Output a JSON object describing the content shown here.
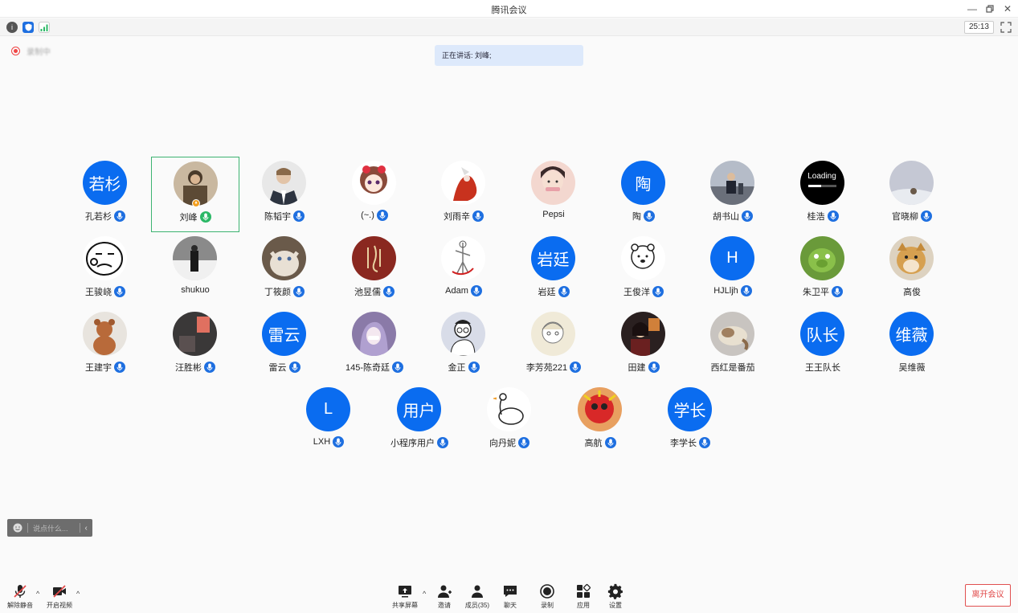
{
  "window": {
    "title": "腾讯会议",
    "timer": "25:13"
  },
  "recording": {
    "label": "录制中"
  },
  "speaking": {
    "text": "正在讲话: 刘峰;"
  },
  "colors": {
    "accent": "#0a6cf0",
    "mic": "#1e6fe0",
    "mic_active": "#2bb866",
    "leave": "#e04848",
    "active_border": "#3cb371"
  },
  "participants": [
    {
      "name": "孔若杉",
      "avatar_text": "若杉",
      "mic": true
    },
    {
      "name": "刘峰",
      "avatar_image": "person-photo",
      "mic": true,
      "speaking": true,
      "host": true
    },
    {
      "name": "陈韬宇",
      "avatar_image": "suit-man-photo",
      "mic": true
    },
    {
      "name": "(~.)",
      "avatar_image": "anime-girl",
      "mic": true
    },
    {
      "name": "刘雨辛",
      "avatar_image": "red-flower-drawing",
      "mic": true
    },
    {
      "name": "Pepsi",
      "avatar_image": "girl-photo",
      "mic": false
    },
    {
      "name": "陶",
      "avatar_text": "陶",
      "mic": true
    },
    {
      "name": "胡书山",
      "avatar_image": "man-sitting-photo",
      "mic": true
    },
    {
      "name": "桂浩",
      "avatar_image": "loading-image",
      "avatar_caption": "Loading",
      "mic": true
    },
    {
      "name": "官晓柳",
      "avatar_image": "snow-photo",
      "mic": true
    },
    {
      "name": "王骏峣",
      "avatar_image": "cartoon-face",
      "mic": true
    },
    {
      "name": "shukuo",
      "avatar_image": "snow-person-photo",
      "mic": false
    },
    {
      "name": "丁筱颜",
      "avatar_image": "cat-photo",
      "mic": true
    },
    {
      "name": "池昱儒",
      "avatar_image": "red-calligraphy",
      "mic": true
    },
    {
      "name": "Adam",
      "avatar_image": "sketch-figure",
      "mic": true
    },
    {
      "name": "岩廷",
      "avatar_text": "岩廷",
      "mic": true
    },
    {
      "name": "王俊洋",
      "avatar_image": "bear-sketch",
      "mic": true
    },
    {
      "name": "HJLljh",
      "avatar_text": "H",
      "mic": true
    },
    {
      "name": "朱卫平",
      "avatar_image": "pig-character",
      "mic": true
    },
    {
      "name": "高俊",
      "avatar_image": "dog-photo",
      "mic": false
    },
    {
      "name": "王建宇",
      "avatar_image": "teddy-bear-photo",
      "mic": true
    },
    {
      "name": "汪胜彬",
      "avatar_image": "dark-room-photo",
      "mic": true
    },
    {
      "name": "雷云",
      "avatar_text": "雷云",
      "mic": true
    },
    {
      "name": "145-陈奇廷",
      "avatar_image": "anime-purple-hair",
      "mic": true
    },
    {
      "name": "金正",
      "avatar_image": "glasses-cartoon",
      "mic": true
    },
    {
      "name": "李芳苑221",
      "avatar_image": "anime-sketch",
      "mic": true
    },
    {
      "name": "田建",
      "avatar_image": "girl-night-photo",
      "mic": true
    },
    {
      "name": "西红是番茄",
      "avatar_image": "cat-sleeping-photo",
      "mic": false
    },
    {
      "name": "王王队长",
      "avatar_text": "队长",
      "mic": false
    },
    {
      "name": "吴维薇",
      "avatar_text": "维薇",
      "mic": false
    },
    {
      "name": "LXH",
      "avatar_text": "L",
      "mic": true
    },
    {
      "name": "小程序用户",
      "avatar_text": "用户",
      "mic": true
    },
    {
      "name": "向丹妮",
      "avatar_image": "goose-drawing",
      "mic": true
    },
    {
      "name": "高航",
      "avatar_image": "red-mask-art",
      "mic": true
    },
    {
      "name": "李学长",
      "avatar_text": "学长",
      "mic": true
    }
  ],
  "chat": {
    "placeholder": "说点什么..."
  },
  "toolbar": {
    "mute": "解除静音",
    "video": "开启视频",
    "share": "共享屏幕",
    "invite": "邀请",
    "members": "成员(35)",
    "chat": "聊天",
    "record": "录制",
    "apps": "应用",
    "settings": "设置",
    "leave": "离开会议"
  }
}
